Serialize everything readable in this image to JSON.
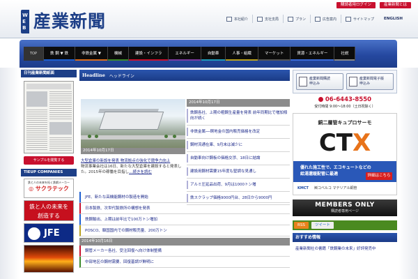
{
  "header": {
    "logo_web": "WEB",
    "logo_title": "産業新聞",
    "top_links": {
      "login": "購読者用ログイン",
      "about": "産業新聞とは"
    },
    "util_nav": [
      "本社紹介",
      "支社支局",
      "プラン",
      "広告案内",
      "サイトマップ"
    ],
    "lang": "ENGLISH"
  },
  "nav": {
    "items": [
      {
        "label": "TOP",
        "color": "#333333"
      },
      {
        "label": "鉄 鋼 ▼ 鉄",
        "color": "#1d5fd1"
      },
      {
        "label": "非鉄金属 ▼",
        "color": "#d86b1d"
      },
      {
        "label": "機械",
        "color": "#3a8a2a"
      },
      {
        "label": "建設・インフラ",
        "color": "#c8102e"
      },
      {
        "label": "エネルギー",
        "color": "#7a3aa0"
      },
      {
        "label": "自動車",
        "color": "#1d9ab8"
      },
      {
        "label": "人事・組織",
        "color": "#b8a01d"
      },
      {
        "label": "マーケット",
        "color": "#555555"
      },
      {
        "label": "資源・エネルギー",
        "color": "#3a6ad8"
      },
      {
        "label": "社説",
        "color": "#888888"
      }
    ]
  },
  "left": {
    "head": "日刊産業新聞紙面",
    "sample_button": "サンプルを閲覧する",
    "tieup_head": "TIEUP COMPANIES",
    "tie1_caption": "鉄と人の未来を拓く鉄鋼メーカー",
    "tie1_brand": "◎ サクラテック",
    "tie2_text": "鉄と人の未来を\n創造する",
    "tie3_text": "JFE"
  },
  "main": {
    "head_en": "Headline",
    "head_ja": "ヘッドライン",
    "feature": {
      "date": "2014年10月17日",
      "title": "大型倉庫の新設を発表 物流拠点の強化で競争力向上",
      "body": "物流事業会社は16日、新たな大型倉庫を建設すると発表した。2015年の稼働を目指し",
      "more": "…続きを読む"
    },
    "right_list": {
      "date": "2014年10月17日",
      "items": [
        "鉄鋼各社、上期の粗鋼生産量を発表 前年同期比で増加傾向が続く",
        "非鉄金属──銅地金の国内販売価格を改定",
        "鋼材流通在庫、9月末は減少に",
        "自動車向け鋼板の価格交渉、18日に結論",
        "建設用鋼材需要15年度も堅調な見通し",
        "アルミ圧延品出荷、9月は1000トン増",
        "鉄スクラップ価格9000円台、28日から9000円"
      ]
    },
    "bottom_list": {
      "items": [
        {
          "text": "JFE、新たな高機能鋼材の製造を開始",
          "color": "#1d5fd1"
        },
        {
          "text": "日本製鉄、次世代製鉄所の構想を発表",
          "color": "#c8102e"
        },
        {
          "text": "鉄鋼輸出、上期は前年比で100万トン増加",
          "color": "#1d5fd1"
        },
        {
          "text": "POSCO、韓国国内での鋼材販売量、200万トン",
          "color": "#b8a01d"
        }
      ],
      "date": "2014年10月16日",
      "items2": [
        {
          "text": "鋼管メーカー各社、受注回復へ向け体制整備",
          "color": "#c8102e"
        },
        {
          "text": "中部地区の鋼材需要、回復基調が鮮明に",
          "color": "#3a8a2a"
        }
      ]
    }
  },
  "right": {
    "sub1": "産業新聞購読\n申込み",
    "sub2": "産業新聞電子版\n申込み",
    "phone": "06-6443-8550",
    "hours": "受付時間 9:00～18:00（土日祝除く）",
    "ctx": {
      "top": "銅二層管キュプロサーモ",
      "big_a": "CT",
      "big_b": "X",
      "mid": "優れた施工性で、エコキュートなどの\n給湯還暖配管に最適",
      "cta": "詳細はこちら",
      "foot_brand": "KMCT",
      "foot": "㈱コベルコ マテリアル銅管"
    },
    "members_a": "MEMBERS ONLY",
    "members_b": "購読者専用ページ",
    "rss": "RSS",
    "tweet": "ツイート",
    "reco_head": "おすすめ情報",
    "reco_text": "産業新聞社の書籍「鉄鋼業の未来」好評発売中"
  }
}
